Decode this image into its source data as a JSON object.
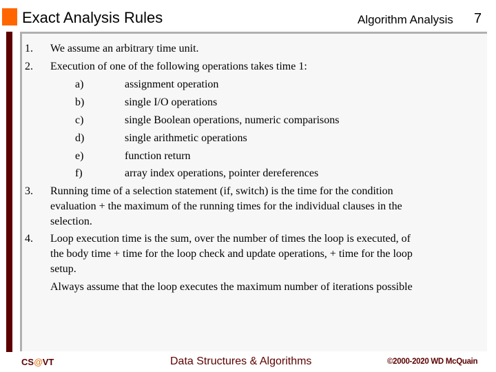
{
  "header": {
    "title": "Exact Analysis Rules",
    "topic": "Algorithm Analysis",
    "page_number": "7"
  },
  "content": {
    "items": [
      {
        "number": "1.",
        "text": "We assume an arbitrary time unit."
      },
      {
        "number": "2.",
        "text": "Execution of one of the following operations takes time 1:",
        "subitems": [
          {
            "label": "a)",
            "text": "assignment operation"
          },
          {
            "label": "b)",
            "text": "single I/O operations"
          },
          {
            "label": "c)",
            "text": "single Boolean operations, numeric comparisons"
          },
          {
            "label": "d)",
            "text": "single arithmetic operations"
          },
          {
            "label": "e)",
            "text": "function return"
          },
          {
            "label": "f)",
            "text": "array index operations, pointer dereferences"
          }
        ]
      },
      {
        "number": "3.",
        "lines": [
          "Running time of a selection statement (if, switch) is the time for the condition",
          "evaluation + the maximum of the running times for the individual clauses in the",
          "selection."
        ]
      },
      {
        "number": "4.",
        "lines": [
          "Loop execution time is the sum, over the number of times the loop is executed, of",
          "the body time + time for the loop check and update operations, + time for the loop",
          "setup."
        ]
      }
    ],
    "note": "Always assume that the loop executes the maximum number of iterations possible"
  },
  "footer": {
    "left_prefix": "CS",
    "left_at": "@",
    "left_suffix": "VT",
    "center": "Data Structures & Algorithms",
    "right": "©2000-2020 WD McQuain"
  },
  "colors": {
    "accent_orange": "#ff6600",
    "maroon": "#5c0000",
    "panel_background": "#f7f7f7",
    "panel_border": "#b0b0b0"
  }
}
